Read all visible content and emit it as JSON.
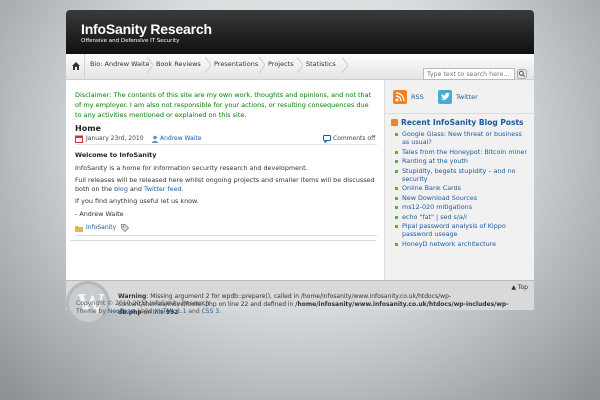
{
  "header": {
    "title": "InfoSanity Research",
    "tagline": "Offensive and Defensive IT Security"
  },
  "nav": {
    "home_icon": "home-icon",
    "items": [
      "Bio: Andrew Waite",
      "Book Reviews",
      "Presentations",
      "Projects",
      "Statistics"
    ],
    "search_placeholder": "Type text to search here..."
  },
  "main": {
    "disclaimer": "Disclaimer: The contents of this site are my own work, thoughts and opinions, and not that of my employer. I am also not responsible for your actions, or resulting consequences due to any activities mentioned or explained on this site.",
    "post": {
      "title": "Home",
      "date": "January 23rd, 2010",
      "author": "Andrew Waite",
      "comments": "Comments off",
      "heading": "Welcome to InfoSanity",
      "para1": "InfoSanity is a home for information security research and development.",
      "para2_a": "Full releases will be released here whilst ongoing projects and smaller items will be discussed both on the ",
      "para2_link1": "blog",
      "para2_b": " and ",
      "para2_link2": "Twitter feed",
      "para2_c": ".",
      "para3": "If you find anything useful let us know.",
      "signature": "- Andrew Waite",
      "category": "InfoSanity"
    }
  },
  "sidebar": {
    "rss_label": "RSS",
    "twitter_label": "Twitter",
    "widget_title": "Recent InfoSanity Blog Posts",
    "posts": [
      "Google Glass: New threat or business as usual?",
      "Tales from the Honeypot: Bitcoin miner",
      "Ranting at the youth",
      "Stupidity, begets stupidity – and no security",
      "Online Bank Cards",
      "New Download Sources",
      "ms12-020 mitigations",
      "echo \"fat\" | sed s/a/i",
      "Pipal password analysis of Kippo password useage",
      "HoneyD network architecture"
    ]
  },
  "footer": {
    "top_link": "▲ Top",
    "warning_label": "Warning",
    "warning_text": ": Missing argument 2 for wpdb::prepare(), called in /home/infosanity/www.infosanity.co.uk/htdocs/wp-content/themes/inove/footer.php on line 22 and defined in ",
    "warning_path": "/home/infosanity/www.infosanity.co.uk/htdocs/wp-includes/wp-db.php",
    "warning_line_prefix": " on line ",
    "warning_line": "992",
    "copyright": "Copyright © 2010-2012 InfoSanity Research",
    "theme_prefix": "Theme by ",
    "theme_author": "NeoEase",
    "valid_prefix": ". Valid ",
    "xhtml": "XHTML 1.1",
    "and": " and ",
    "css": "CSS 3",
    "end": "."
  }
}
